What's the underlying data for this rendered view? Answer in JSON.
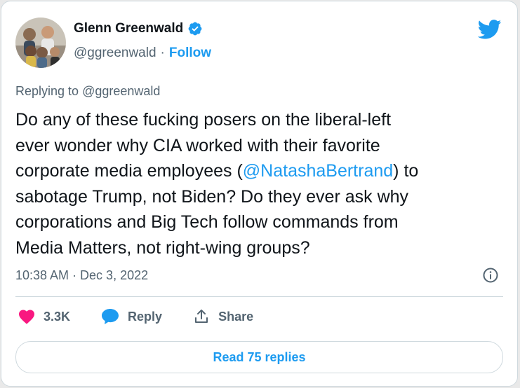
{
  "author": {
    "name": "Glenn Greenwald",
    "handle": "@ggreenwald",
    "separator": "·",
    "follow_label": "Follow"
  },
  "reply_context": {
    "prefix": "Replying to ",
    "handle": "@ggreenwald"
  },
  "tweet": {
    "text_part1": "Do any of these fucking posers on the liberal-left\never wonder why CIA worked with their favorite\ncorporate media employees (",
    "mention": "@NatashaBertrand",
    "text_part2": ") to\nsabotage Trump, not Biden? Do they ever ask why\ncorporations and Big Tech follow commands from\nMedia Matters, not right-wing groups?",
    "timestamp": "10:38 AM · Dec 3, 2022"
  },
  "actions": {
    "likes": "3.3K",
    "reply_label": "Reply",
    "share_label": "Share"
  },
  "read_replies_label": "Read 75 replies",
  "icons": {
    "verified": "verified-badge-icon",
    "twitter": "twitter-bird-icon",
    "info": "info-icon",
    "heart": "heart-icon",
    "reply": "reply-bubble-icon",
    "share": "share-icon"
  },
  "colors": {
    "accent": "#1d9bf0",
    "like": "#f91880",
    "text": "#0f1419",
    "secondary": "#536471",
    "border": "#cfd9de"
  }
}
